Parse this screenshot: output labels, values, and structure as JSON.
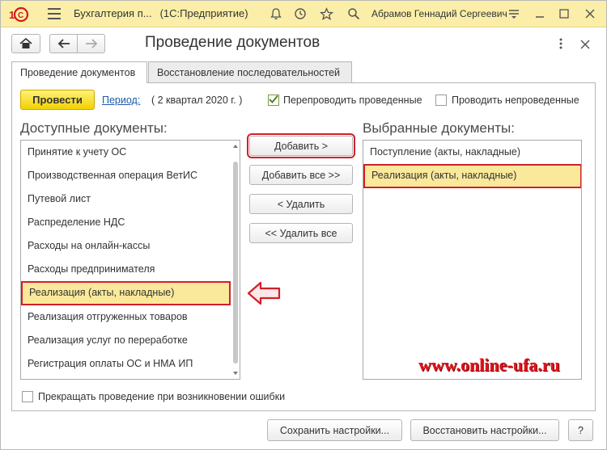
{
  "titlebar": {
    "title": "Бухгалтерия п...",
    "app": "(1С:Предприятие)",
    "user": "Абрамов Геннадий Сергеевич",
    "icons": [
      "1c-logo-icon",
      "menu-icon",
      "bell-icon",
      "history-icon",
      "star-icon",
      "search-icon",
      "settings-menu-icon",
      "minimize-icon",
      "maximize-icon",
      "close-icon"
    ]
  },
  "header": {
    "title": "Проведение документов"
  },
  "tabs": [
    {
      "label": "Проведение документов",
      "active": true
    },
    {
      "label": "Восстановление последовательностей",
      "active": false
    }
  ],
  "controls": {
    "post_button": "Провести",
    "period_link": "Период:",
    "period_value": "( 2 квартал 2020 г. )",
    "repost_label": "Перепроводить проведенные",
    "repost_checked": true,
    "post_unposted_label": "Проводить непроведенные",
    "post_unposted_checked": false
  },
  "available": {
    "heading": "Доступные документы:",
    "items": [
      "Принятие к учету ОС",
      "Производственная операция ВетИС",
      "Путевой лист",
      "Распределение НДС",
      "Расходы на онлайн-кассы",
      "Расходы предпринимателя",
      "Реализация (акты, накладные)",
      "Реализация отгруженных товаров",
      "Реализация услуг по переработке",
      "Регистрация оплаты ОС и НМА ИП"
    ],
    "selected_index": 6
  },
  "actions": {
    "add": "Добавить >",
    "add_all": "Добавить все >>",
    "remove": "< Удалить",
    "remove_all": "<< Удалить все"
  },
  "selected": {
    "heading": "Выбранные документы:",
    "items": [
      "Поступление (акты, накладные)",
      "Реализация (акты, накладные)"
    ],
    "selected_index": 1
  },
  "watermark": "www.online-ufa.ru",
  "stop_on_error": {
    "label": "Прекращать проведение при возникновении ошибки",
    "checked": false
  },
  "footer": {
    "save": "Сохранить настройки...",
    "restore": "Восстановить настройки...",
    "help": "?"
  },
  "colors": {
    "titlebar": "#fbeea8",
    "post_button": "#f3d100",
    "highlight": "#fae99b",
    "callout_red": "#d0202a",
    "link": "#1b5ba8"
  }
}
